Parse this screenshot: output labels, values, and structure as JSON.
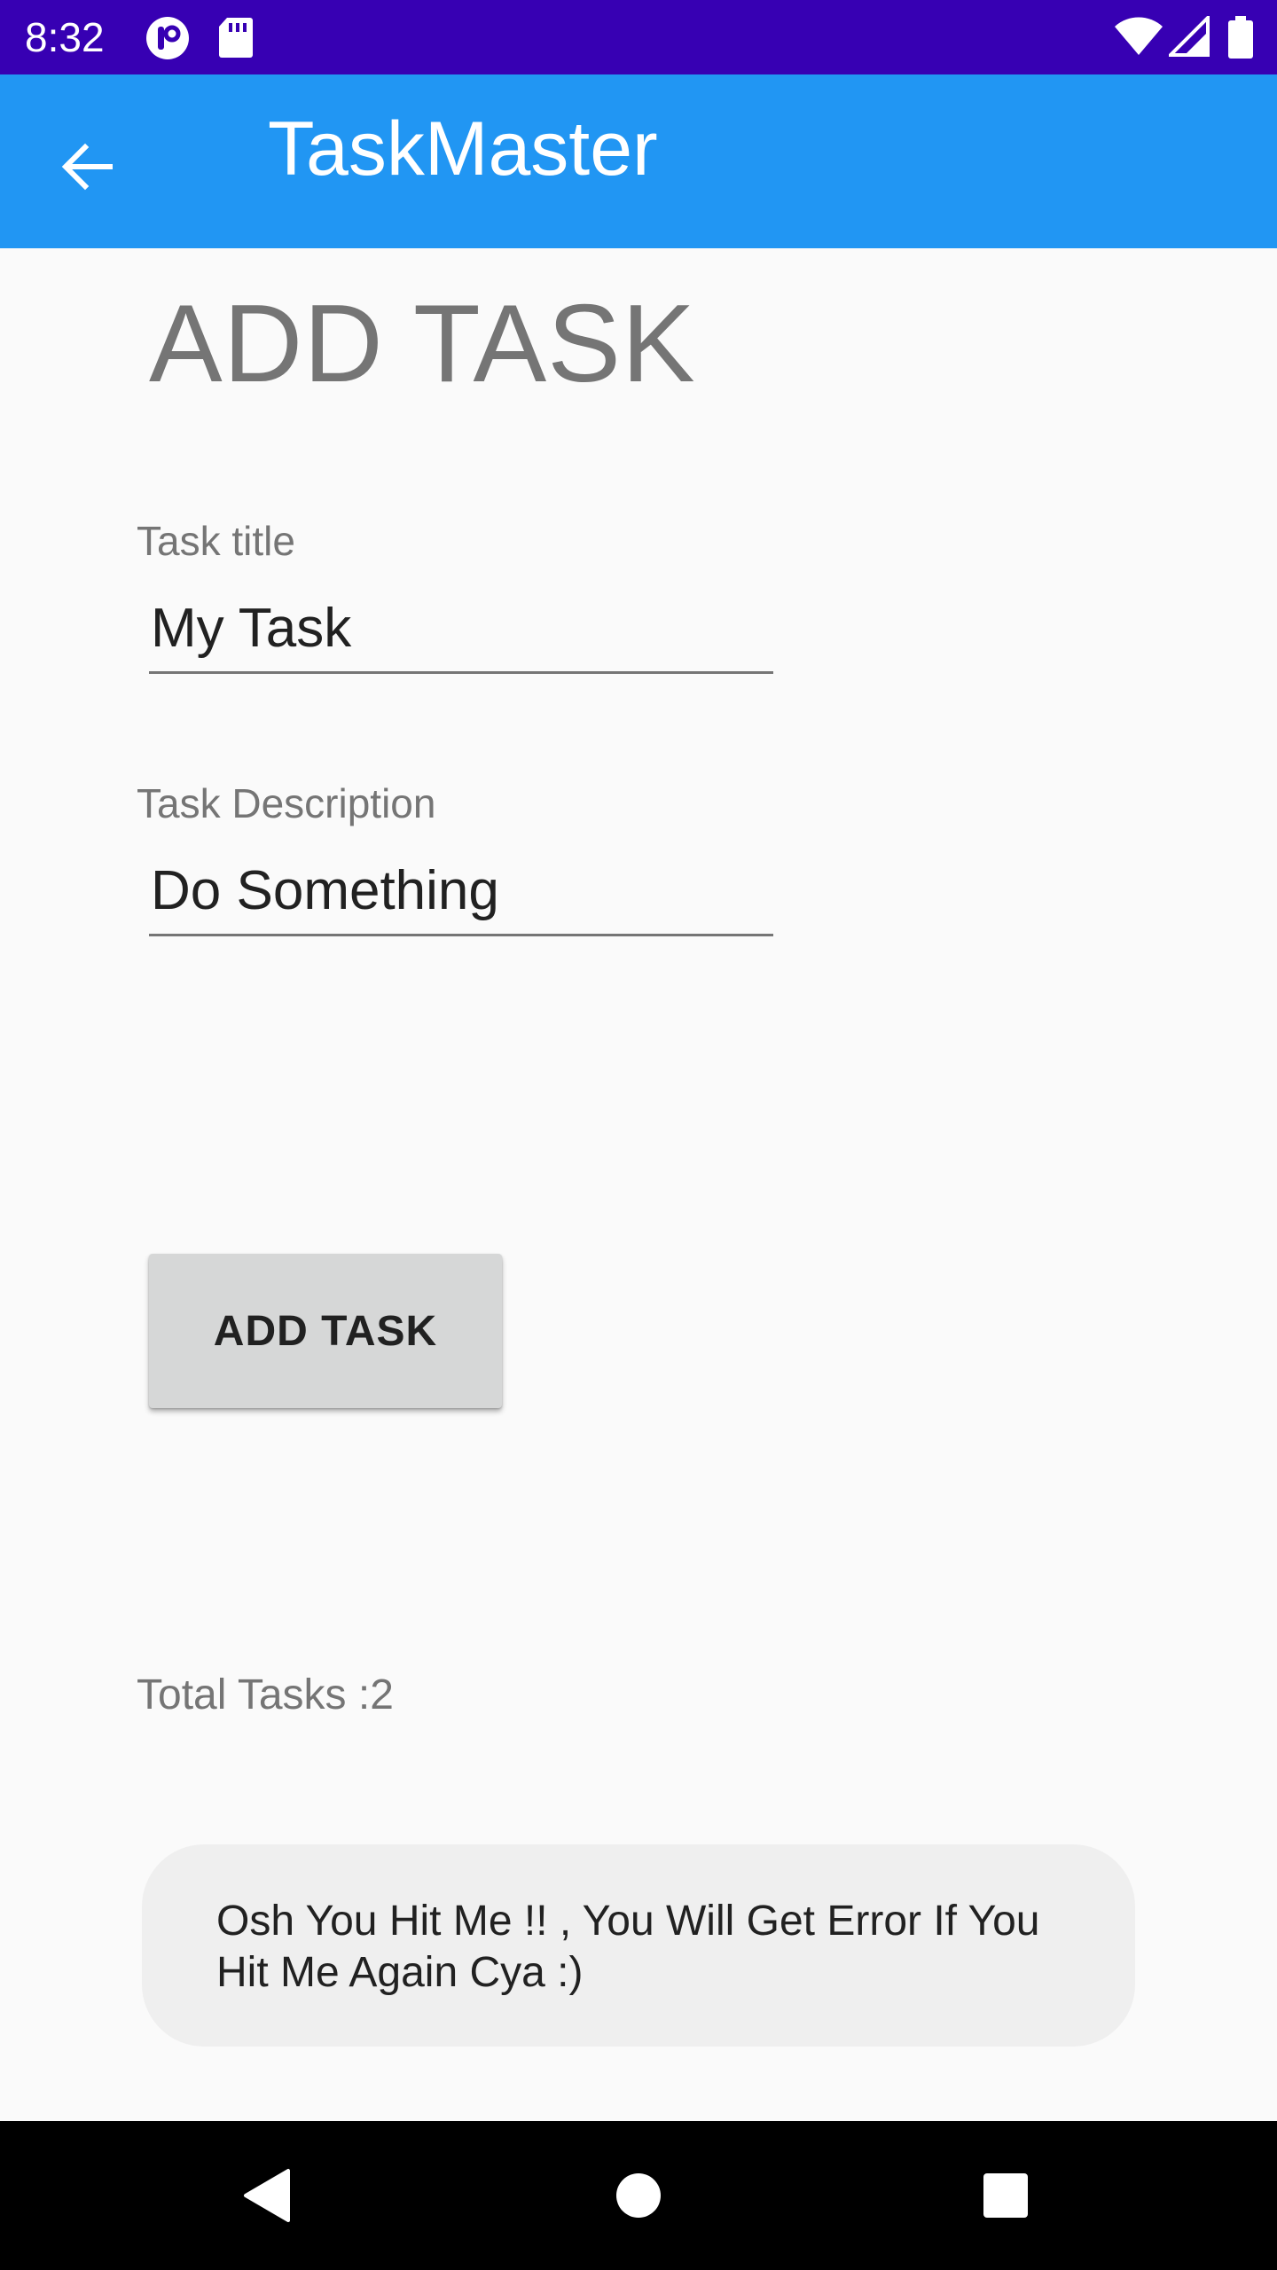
{
  "status_bar": {
    "time": "8:32",
    "left_icons": [
      "app-notification-icon",
      "sd-card-icon"
    ],
    "right_icons": [
      "wifi-icon",
      "cell-signal-icon",
      "battery-icon"
    ],
    "background": "#3700b3"
  },
  "app_bar": {
    "title": "TaskMaster",
    "back_icon": "arrow-back-icon",
    "background": "#2196f3"
  },
  "page": {
    "heading": "ADD TASK"
  },
  "form": {
    "title_label": "Task title",
    "title_value": "My Task",
    "description_label": "Task Description",
    "description_value": "Do Something",
    "submit_label": "ADD TASK"
  },
  "total_tasks": "Total Tasks :2",
  "toast": {
    "message": "Osh You Hit Me !! , You Will Get Error If You\nHit Me Again  Cya :)"
  },
  "nav_bar": {
    "icons": [
      "back-triangle-icon",
      "home-circle-icon",
      "recents-square-icon"
    ]
  }
}
